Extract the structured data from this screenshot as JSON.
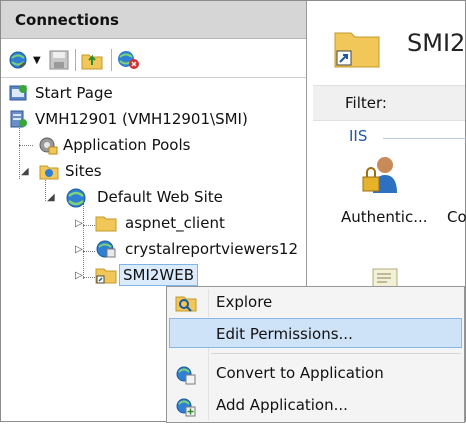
{
  "connections": {
    "header": "Connections",
    "toolbar": [
      "connect-icon",
      "save-icon",
      "up-folder-icon",
      "disconnect-icon"
    ],
    "tree": {
      "start_page": "Start Page",
      "server": "VMH12901 (VMH12901\\SMI)",
      "app_pools": "Application Pools",
      "sites": "Sites",
      "default_site": "Default Web Site",
      "aspnet_client": "aspnet_client",
      "crystal": "crystalreportviewers12",
      "smi2web": "SMI2WEB"
    }
  },
  "right_pane": {
    "title": "SMI2",
    "filter_label": "Filter:",
    "group_label": "IIS",
    "features": [
      "Authentic...",
      "Co"
    ]
  },
  "context_menu": {
    "items": [
      {
        "label": "Explore",
        "icon": "explore-icon"
      },
      {
        "label": "Edit Permissions...",
        "icon": "",
        "highlighted": true
      },
      {
        "label": "Convert to Application",
        "icon": "convert-app-icon"
      },
      {
        "label": "Add Application...",
        "icon": "add-app-icon"
      }
    ]
  },
  "colors": {
    "header_bg": "#d6d6d6",
    "highlight_bg": "#cfe3f8",
    "link_blue": "#1e5aa8"
  }
}
